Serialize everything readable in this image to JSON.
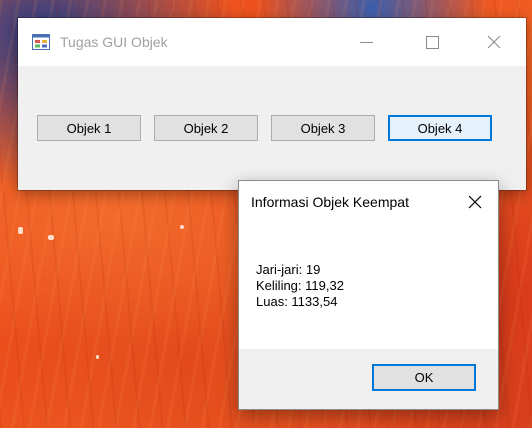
{
  "main_window": {
    "title": "Tugas GUI Objek",
    "buttons": [
      "Objek 1",
      "Objek 2",
      "Objek 3",
      "Objek 4"
    ],
    "focused_button": "Objek 4"
  },
  "dialog": {
    "title": "Informasi Objek Keempat",
    "lines": [
      "Jari-jari: 19",
      "Keliling: 119,32",
      "Luas: 1133,54"
    ],
    "ok_label": "OK"
  },
  "icons": {
    "app": "app-window-icon",
    "minimize": "minimize-icon",
    "maximize": "maximize-icon",
    "close": "close-icon"
  },
  "colors": {
    "accent": "#0078d7",
    "button_face": "#e1e1e1",
    "window_bg": "#f0f0f0"
  }
}
